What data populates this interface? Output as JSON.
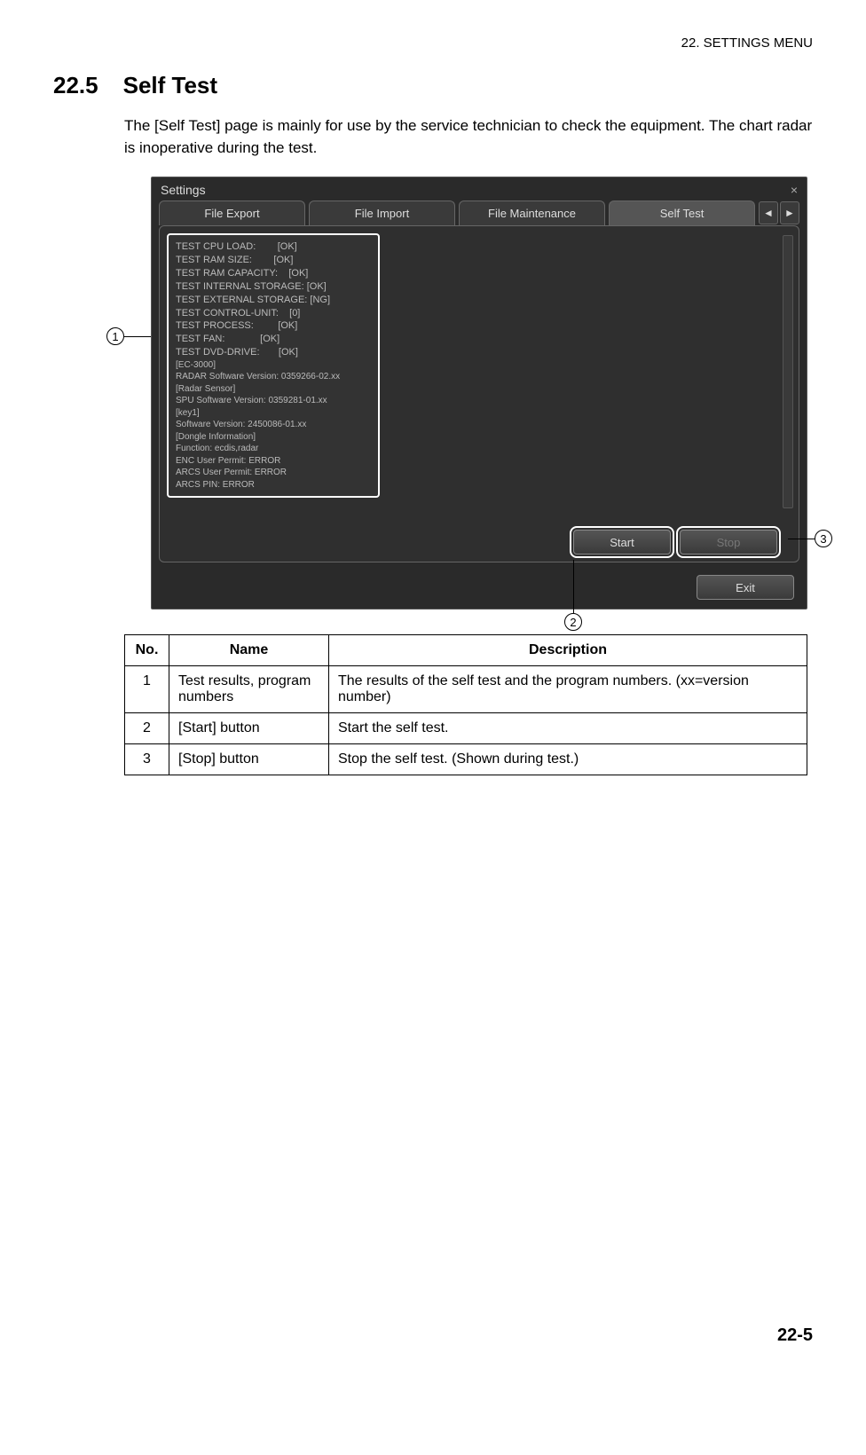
{
  "header": {
    "chapter": "22.  SETTINGS MENU"
  },
  "section": {
    "number": "22.5",
    "title": "Self Test"
  },
  "intro": "The [Self Test] page is mainly for use by the service technician to check the equipment. The chart radar is inoperative during the test.",
  "window": {
    "title": "Settings",
    "tabs": [
      "File Export",
      "File Import",
      "File Maintenance",
      "Self Test"
    ],
    "activeTabIndex": 3,
    "results": [
      "TEST CPU LOAD:        [OK]",
      "TEST RAM SIZE:        [OK]",
      "TEST RAM CAPACITY:    [OK]",
      "TEST INTERNAL STORAGE: [OK]",
      "TEST EXTERNAL STORAGE: [NG]",
      "TEST CONTROL-UNIT:    [0]",
      "TEST PROCESS:         [OK]",
      "TEST FAN:             [OK]",
      "TEST DVD-DRIVE:       [OK]"
    ],
    "software": [
      "[EC-3000]",
      "RADAR Software Version:  0359266-02.xx",
      "[Radar Sensor]",
      "SPU Software Version:  0359281-01.xx",
      "[key1]",
      "Software Version: 2450086-01.xx",
      "",
      "[Dongle Information]",
      "Function:  ecdis,radar",
      "ENC User Permit:  ERROR",
      "ARCS User Permit:  ERROR",
      "ARCS PIN:  ERROR"
    ],
    "buttons": {
      "start": "Start",
      "stop": "Stop",
      "exit": "Exit"
    }
  },
  "callouts": {
    "c1": "1",
    "c2": "2",
    "c3": "3"
  },
  "table": {
    "headers": {
      "no": "No.",
      "name": "Name",
      "desc": "Description"
    },
    "rows": [
      {
        "no": "1",
        "name": "Test results, program numbers",
        "desc": "The results of the self test and the program numbers. (xx=version number)"
      },
      {
        "no": "2",
        "name": "[Start] button",
        "desc": "Start the self test."
      },
      {
        "no": "3",
        "name": "[Stop] button",
        "desc": "Stop the self test. (Shown during test.)"
      }
    ]
  },
  "pageNumber": "22-5"
}
